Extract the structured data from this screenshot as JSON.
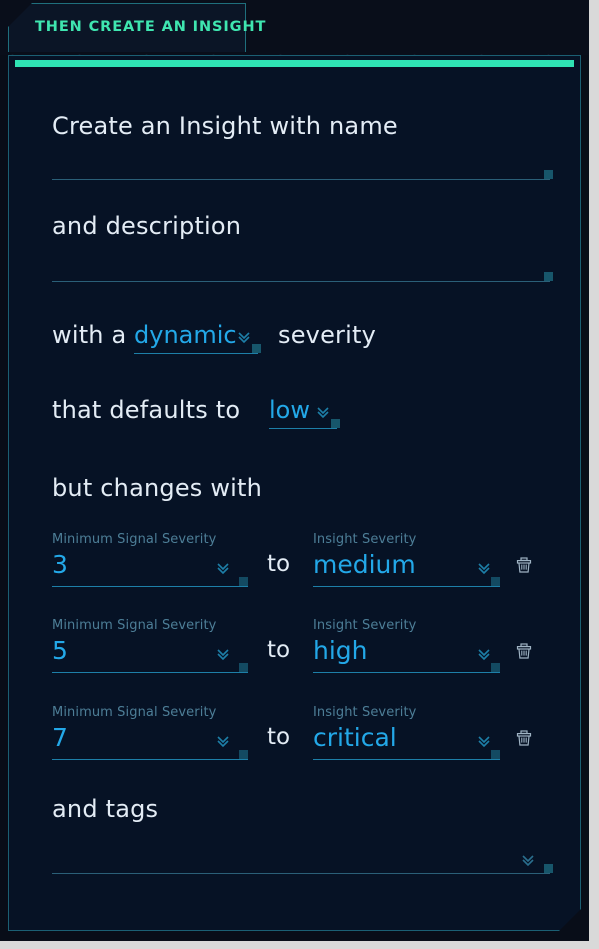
{
  "theme": {
    "page_bg": "#d9d9d9",
    "app_bg": "#080d18",
    "panel_bg": "#061225",
    "panel_border": "#1b5f73",
    "accent_green": "#2fe3b4",
    "accent_blue": "#23a8e8",
    "label_muted": "#4d7e97",
    "text_primary": "#e3ecf5"
  },
  "tab": {
    "label": "THEN CREATE AN INSIGHT",
    "active": true
  },
  "form": {
    "name_prompt": "Create an Insight with name",
    "name_value": "",
    "description_prompt": "and description",
    "description_value": "",
    "severity_mode": {
      "prefix": "with a",
      "value": "dynamic",
      "suffix": "severity",
      "icon": "chevron-double-down-icon"
    },
    "default_severity": {
      "prefix": "that defaults to",
      "value": "low",
      "icon": "chevron-double-down-icon"
    },
    "changes_heading": "but changes with",
    "mapping_rows": [
      {
        "signal_label": "Minimum Signal Severity",
        "signal_value": "3",
        "separator": "to",
        "insight_label": "Insight Severity",
        "insight_value": "medium",
        "delete_icon": "trash-icon"
      },
      {
        "signal_label": "Minimum Signal Severity",
        "signal_value": "5",
        "separator": "to",
        "insight_label": "Insight Severity",
        "insight_value": "high",
        "delete_icon": "trash-icon"
      },
      {
        "signal_label": "Minimum Signal Severity",
        "signal_value": "7",
        "separator": "to",
        "insight_label": "Insight Severity",
        "insight_value": "critical",
        "delete_icon": "trash-icon"
      }
    ],
    "tags": {
      "prompt": "and tags",
      "value": "",
      "icon": "chevron-double-down-icon"
    }
  }
}
